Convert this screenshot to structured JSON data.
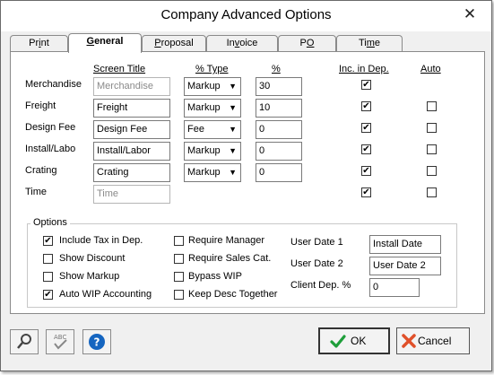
{
  "window": {
    "title": "Company Advanced Options",
    "close_glyph": "✕"
  },
  "tabs": [
    {
      "pre": "Pr",
      "u": "i",
      "post": "nt",
      "active": false
    },
    {
      "pre": "",
      "u": "G",
      "post": "eneral",
      "active": true
    },
    {
      "pre": "",
      "u": "P",
      "post": "roposal",
      "active": false
    },
    {
      "pre": "In",
      "u": "v",
      "post": "oice",
      "active": false
    },
    {
      "pre": "P",
      "u": "O",
      "post": "",
      "active": false
    },
    {
      "pre": "Ti",
      "u": "m",
      "post": "e",
      "active": false
    }
  ],
  "headers": {
    "screen_title": "Screen Title",
    "pct_type": "% Type",
    "pct": "%",
    "inc_in_dep": "Inc. in Dep.",
    "auto": "Auto"
  },
  "rows": [
    {
      "label": "Merchandise",
      "title": "Merchandise",
      "title_disabled": true,
      "type": "Markup",
      "pct": "30",
      "inc": true,
      "auto": null
    },
    {
      "label": "Freight",
      "title": "Freight",
      "title_disabled": false,
      "type": "Markup",
      "pct": "10",
      "inc": true,
      "auto": false
    },
    {
      "label": "Design Fee",
      "title": "Design Fee",
      "title_disabled": false,
      "type": "Fee",
      "pct": "0",
      "inc": true,
      "auto": false
    },
    {
      "label": "Install/Labo",
      "title": "Install/Labor",
      "title_disabled": false,
      "type": "Markup",
      "pct": "0",
      "inc": true,
      "auto": false
    },
    {
      "label": "Crating",
      "title": "Crating",
      "title_disabled": false,
      "type": "Markup",
      "pct": "0",
      "inc": true,
      "auto": false
    },
    {
      "label": "Time",
      "title": "Time",
      "title_disabled": true,
      "type": null,
      "pct": null,
      "inc": true,
      "auto": false
    }
  ],
  "options": {
    "group_title": "Options",
    "col1": [
      {
        "label": "Include Tax in Dep.",
        "checked": true
      },
      {
        "label": "Show Discount",
        "checked": false
      },
      {
        "label": "Show Markup",
        "checked": false
      },
      {
        "label": "Auto WIP Accounting",
        "checked": true
      }
    ],
    "col2": [
      {
        "label": "Require Manager",
        "checked": false
      },
      {
        "label": "Require Sales Cat.",
        "checked": false
      },
      {
        "label": "Bypass WIP",
        "checked": false
      },
      {
        "label": "Keep Desc Together",
        "checked": false
      }
    ],
    "user_date_1_label": "User Date 1",
    "user_date_1_value": "Install Date",
    "user_date_2_label": "User Date 2",
    "user_date_2_value": "User Date 2",
    "client_dep_label": "Client Dep. %",
    "client_dep_value": "0"
  },
  "footer": {
    "ok_label": "OK",
    "cancel_label": "Cancel",
    "icons": [
      "search-icon",
      "spellcheck-icon",
      "help-icon"
    ]
  },
  "colors": {
    "ok_check": "#1e9e3a",
    "cancel_x": "#e0502a",
    "help_blue": "#1565c0"
  },
  "dropdown_arrow": "▼",
  "check_glyph": "✔"
}
